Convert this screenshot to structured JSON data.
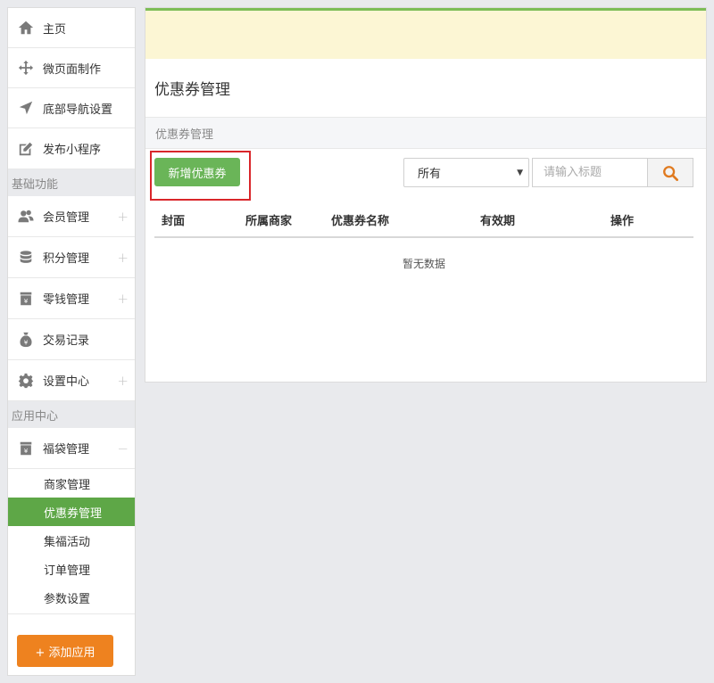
{
  "sidebar": {
    "top_items": [
      {
        "label": "主页",
        "icon": "home-icon"
      },
      {
        "label": "微页面制作",
        "icon": "move-icon"
      },
      {
        "label": "底部导航设置",
        "icon": "navigation-arrow-icon"
      },
      {
        "label": "发布小程序",
        "icon": "edit-icon"
      }
    ],
    "section_basic": "基础功能",
    "basic_items": [
      {
        "label": "会员管理",
        "icon": "users-icon",
        "expand": "+"
      },
      {
        "label": "积分管理",
        "icon": "database-icon",
        "expand": "+"
      },
      {
        "label": "零钱管理",
        "icon": "cash-can-icon",
        "expand": "+"
      },
      {
        "label": "交易记录",
        "icon": "money-bag-icon",
        "expand": ""
      },
      {
        "label": "设置中心",
        "icon": "gear-icon",
        "expand": "+"
      }
    ],
    "section_apps": "应用中心",
    "app_group": {
      "label": "福袋管理",
      "icon": "cash-can-icon",
      "expand": "−"
    },
    "sub_items": [
      {
        "label": "商家管理",
        "active": false
      },
      {
        "label": "优惠券管理",
        "active": true
      },
      {
        "label": "集福活动",
        "active": false
      },
      {
        "label": "订单管理",
        "active": false
      },
      {
        "label": "参数设置",
        "active": false
      }
    ],
    "add_app_label": "+ 添加应用"
  },
  "main": {
    "title": "优惠券管理",
    "breadcrumb": "优惠券管理",
    "add_button": "新增优惠券",
    "filter_selected": "所有",
    "search_placeholder": "请输入标题",
    "columns": [
      "封面",
      "所属商家",
      "优惠券名称",
      "有效期",
      "操作"
    ],
    "empty_text": "暂无数据"
  },
  "colors": {
    "accent_green": "#5ea747",
    "button_green": "#6ab558",
    "orange": "#ee821f",
    "highlight_red": "#d9262a",
    "notice_bg": "#fcf6d4"
  }
}
